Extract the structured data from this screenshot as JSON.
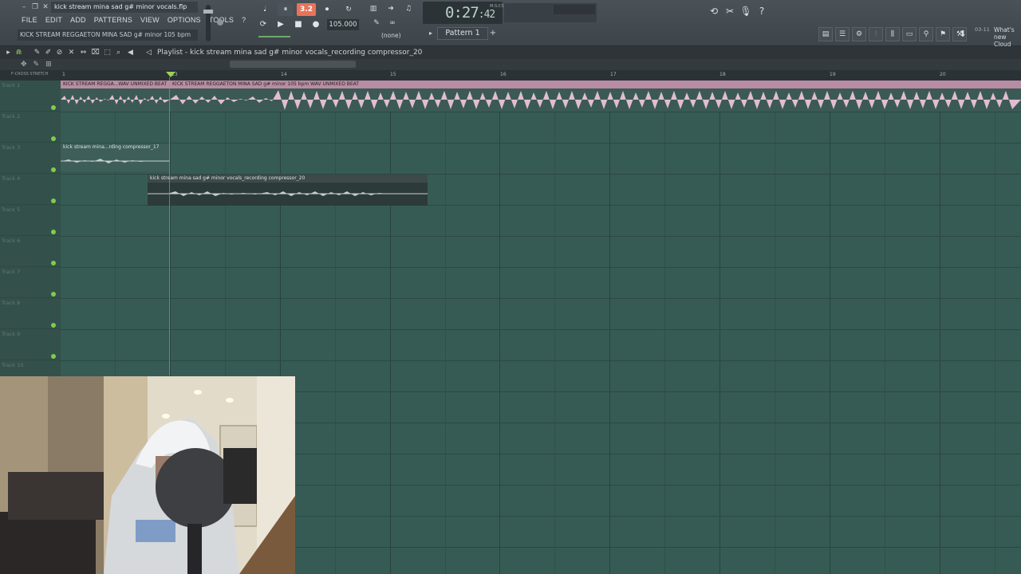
{
  "window": {
    "title": "kick stream mina sad g# minor vocals.flp",
    "hint": "KICK STREAM REGGAETON MINA SAD g# minor 105 bpm"
  },
  "menu": [
    "FILE",
    "EDIT",
    "ADD",
    "PATTERNS",
    "VIEW",
    "OPTIONS",
    "TOOLS",
    "?"
  ],
  "transport": {
    "pattern_song_label": "3.2",
    "bpm": "105.000",
    "time": "0:27",
    "time_frac": ":42",
    "time_unit": "M:S:CS",
    "snap": "(none)",
    "pattern": "Pattern 1"
  },
  "news": {
    "date": "03-11",
    "text": "What's new Cloud Pro?"
  },
  "playlist": {
    "title": "Playlist - kick stream mina sad g# minor vocals_recording compressor_20",
    "ruler_labels": [
      "13",
      "14",
      "15",
      "16",
      "17",
      "18",
      "19",
      "20"
    ],
    "ruler_switch": "F-CROSS  STRETCH"
  },
  "tracks": [
    "Track 1",
    "Track 2",
    "Track 3",
    "Track 4",
    "Track 5",
    "Track 6",
    "Track 7",
    "Track 8",
    "Track 9",
    "Track 10"
  ],
  "clips": {
    "beat_a": "KICK STREAM REGGA...WAV UNMIXED BEAT",
    "beat_b": "KICK STREAM REGGAETON MINA SAD g# minor 105 bpm WAV UNMIXED BEAT",
    "vox_a": "kick stream mina...rding compressor_17",
    "vox_b": "kick stream mina sad g# minor vocals_recording compressor_20"
  },
  "colors": {
    "accent": "#e8735a",
    "grid": "#365b54",
    "audio_clip": "#b88da3"
  }
}
